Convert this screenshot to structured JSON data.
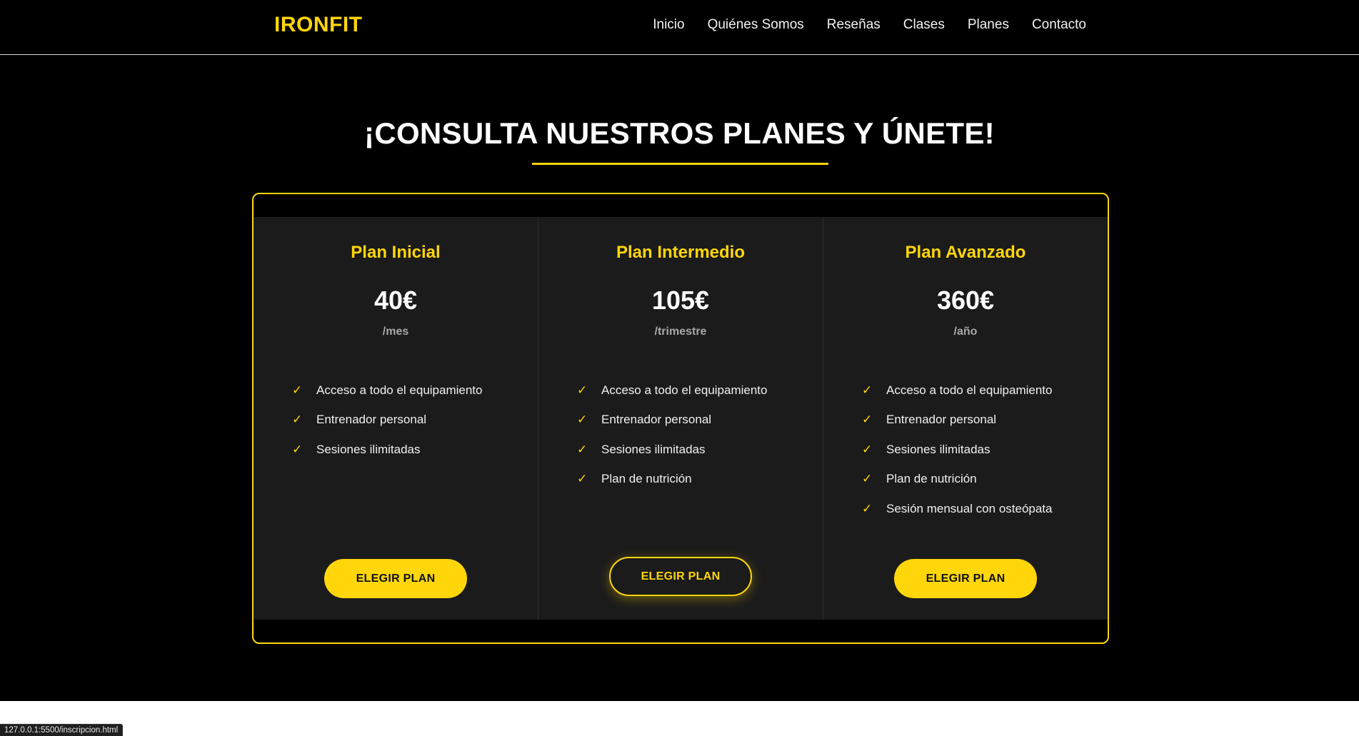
{
  "header": {
    "logo": "IRONFIT",
    "nav": [
      "Inicio",
      "Quiénes Somos",
      "Reseñas",
      "Clases",
      "Planes",
      "Contacto"
    ]
  },
  "section": {
    "title": "¡CONSULTA NUESTROS PLANES Y ÚNETE!"
  },
  "plans": [
    {
      "name": "Plan Inicial",
      "price": "40€",
      "period": "/mes",
      "features": [
        "Acceso a todo el equipamiento",
        "Entrenador personal",
        "Sesiones ilimitadas"
      ],
      "button": "ELEGIR PLAN"
    },
    {
      "name": "Plan Intermedio",
      "price": "105€",
      "period": "/trimestre",
      "features": [
        "Acceso a todo el equipamiento",
        "Entrenador personal",
        "Sesiones ilimitadas",
        "Plan de nutrición"
      ],
      "button": "ELEGIR PLAN"
    },
    {
      "name": "Plan Avanzado",
      "price": "360€",
      "period": "/año",
      "features": [
        "Acceso a todo el equipamiento",
        "Entrenador personal",
        "Sesiones ilimitadas",
        "Plan de nutrición",
        "Sesión mensual con osteópata"
      ],
      "button": "ELEGIR PLAN"
    }
  ],
  "check_glyph": "✓",
  "status_url": "127.0.0.1:5500/inscripcion.html",
  "colors": {
    "accent": "#ffd60a",
    "background": "#000000",
    "card": "#1b1b1b"
  }
}
